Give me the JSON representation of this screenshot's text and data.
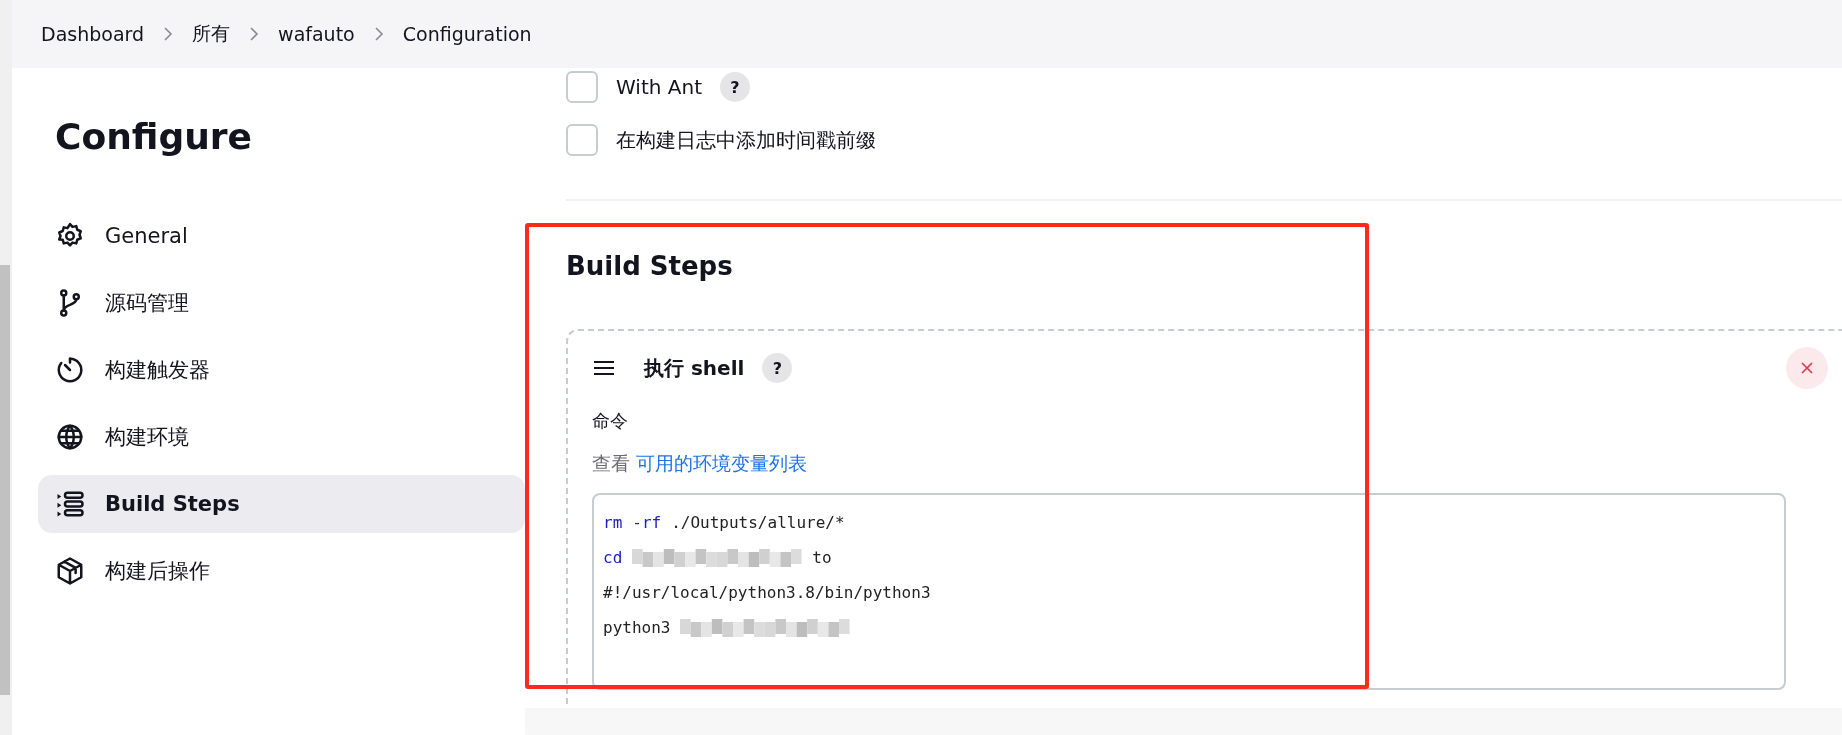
{
  "breadcrumbs": [
    {
      "label": "Dashboard"
    },
    {
      "label": "所有"
    },
    {
      "label": "wafauto"
    },
    {
      "label": "Configuration"
    }
  ],
  "sidebar": {
    "title": "Configure",
    "items": [
      {
        "label": "General",
        "selected": false
      },
      {
        "label": "源码管理",
        "selected": false
      },
      {
        "label": "构建触发器",
        "selected": false
      },
      {
        "label": "构建环境",
        "selected": false
      },
      {
        "label": "Build Steps",
        "selected": true
      },
      {
        "label": "构建后操作",
        "selected": false
      }
    ]
  },
  "options": [
    {
      "label": "With Ant",
      "checked": false,
      "help": "?"
    },
    {
      "label": "在构建日志中添加时间戳前缀",
      "checked": false
    }
  ],
  "section": {
    "title": "Build Steps",
    "annotation": {
      "kind": "frame",
      "color": "#ff2a1a"
    },
    "step": {
      "title": "执行 shell",
      "help": "?",
      "field_label": "命令",
      "hint": "查看",
      "hint_link": "可用的环境变量列表",
      "lines": [
        [
          {
            "kind": "keyword",
            "text": "rm"
          },
          {
            "kind": "keyword",
            "text": "-rf"
          },
          {
            "kind": "plain",
            "text": "./Outputs/allure/*"
          }
        ],
        [
          {
            "kind": "keyword",
            "text": "cd"
          },
          {
            "kind": "redacted"
          },
          {
            "kind": "plain",
            "text": "to"
          }
        ],
        [
          {
            "kind": "plain",
            "text": "#!/usr/local/python3.8/bin/python3"
          }
        ],
        [
          {
            "kind": "plain",
            "text": "python3"
          },
          {
            "kind": "redacted"
          }
        ]
      ]
    }
  }
}
